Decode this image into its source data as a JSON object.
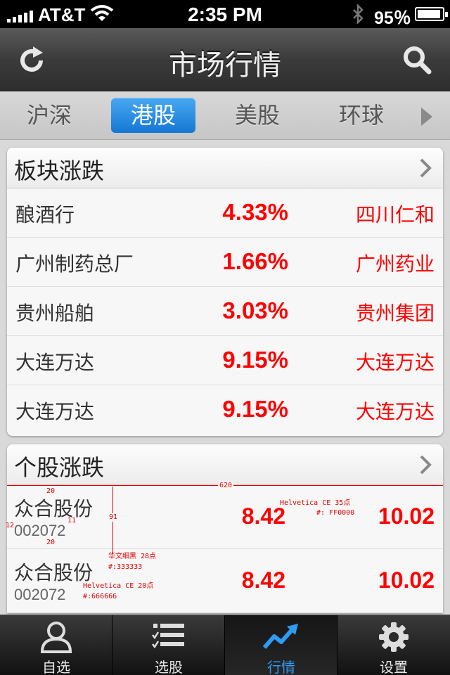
{
  "status_bar": {
    "carrier": "AT&T",
    "time": "2:35 PM",
    "battery_percent": "95％",
    "battery_level": 0.95
  },
  "nav": {
    "title": "市场行情",
    "refresh_icon": "refresh-icon",
    "search_icon": "search-icon"
  },
  "market_tabs": [
    {
      "label": "沪深",
      "active": false
    },
    {
      "label": "港股",
      "active": true
    },
    {
      "label": "美股",
      "active": false
    },
    {
      "label": "环球",
      "active": false
    }
  ],
  "sector_card": {
    "title": "板块涨跌",
    "rows": [
      {
        "name": "酿酒行",
        "change": "4.33%",
        "leader": "四川仁和"
      },
      {
        "name": "广州制药总厂",
        "change": "1.66%",
        "leader": "广州药业"
      },
      {
        "name": "贵州船舶",
        "change": "3.03%",
        "leader": "贵州集团"
      },
      {
        "name": "大连万达",
        "change": "9.15%",
        "leader": "大连万达"
      },
      {
        "name": "大连万达",
        "change": "9.15%",
        "leader": "大连万达"
      }
    ]
  },
  "stock_card": {
    "title": "个股涨跌",
    "rows": [
      {
        "name": "众合股份",
        "code": "002072",
        "price": "8.42",
        "value": "10.02"
      },
      {
        "name": "众合股份",
        "code": "002072",
        "price": "8.42",
        "value": "10.02"
      }
    ]
  },
  "annotations": {
    "width": "620",
    "gap_top": "20",
    "gap_left": "12",
    "gap_mid": "11",
    "gap_bottom": "20",
    "row_height": "91",
    "font_price_name": "Helvetica CE  35点",
    "font_price_color": "#: FF0000",
    "font_name_name": "华文细黑 28点",
    "font_name_color": "#:333333",
    "font_code_name": "Helvetica CE 20点",
    "font_code_color": "#:666666"
  },
  "tab_bar": [
    {
      "label": "自选",
      "icon": "person-icon",
      "active": false
    },
    {
      "label": "选股",
      "icon": "list-icon",
      "active": false
    },
    {
      "label": "行情",
      "icon": "trend-icon",
      "active": true
    },
    {
      "label": "设置",
      "icon": "gear-icon",
      "active": false
    }
  ],
  "colors": {
    "accent_blue": "#1677d4",
    "up_red": "#ff0000",
    "name_text": "#333333",
    "code_text": "#666666"
  }
}
